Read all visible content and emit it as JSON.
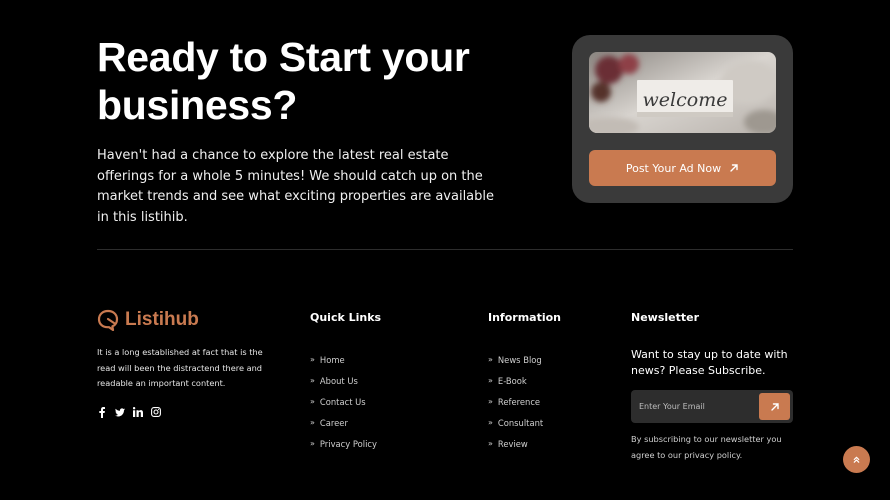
{
  "hero": {
    "title": "Ready to Start your business?",
    "text": "Haven't had a chance to explore the latest real estate offerings for a whole 5 minutes! We should catch up on the market trends and see what exciting properties are available in this listihib."
  },
  "cta": {
    "image_alt": "welcome",
    "button_label": "Post Your Ad Now",
    "button_icon": "arrow-up-right-icon"
  },
  "brand": {
    "name": "Listihub",
    "icon": "chat-bubble-logo-icon",
    "description": "It is a long established at fact that is the read will been the distractend there and readable an important content.",
    "socials": [
      "facebook-icon",
      "twitter-icon",
      "linkedin-icon",
      "instagram-icon"
    ]
  },
  "quick_links": {
    "title": "Quick Links",
    "items": [
      "Home",
      "About Us",
      "Contact Us",
      "Career",
      "Privacy Policy"
    ]
  },
  "information": {
    "title": "Information",
    "items": [
      "News Blog",
      "E-Book",
      "Reference",
      "Consultant",
      "Review"
    ]
  },
  "newsletter": {
    "title": "Newsletter",
    "text": "Want to stay up to date with news? Please Subscribe.",
    "placeholder": "Enter Your Email",
    "note": "By subscribing to our newsletter you agree to our privacy policy."
  },
  "colors": {
    "accent": "#c97a50",
    "background": "#000000",
    "card": "#3a3a3a"
  }
}
